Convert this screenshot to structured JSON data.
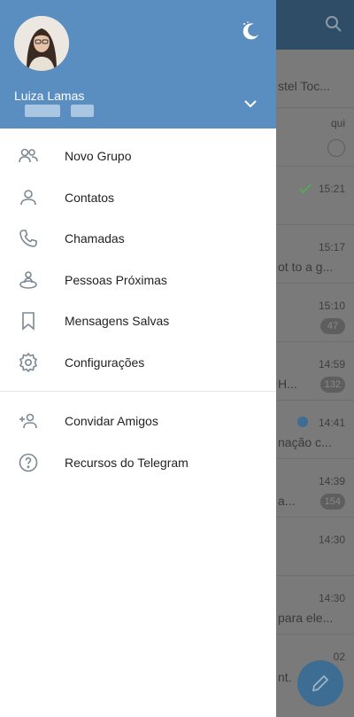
{
  "colors": {
    "drawer_header": "#5b8ec0",
    "app_header": "#2f4d66",
    "fab": "#3e6d93",
    "accent_check": "#4caf50"
  },
  "drawer": {
    "user_name": "Luiza Lamas",
    "theme_toggle_icon": "moon-icon",
    "expand_icon": "chevron-down-icon",
    "menu": [
      {
        "label": "Novo Grupo",
        "icon": "group-icon"
      },
      {
        "label": "Contatos",
        "icon": "contact-icon"
      },
      {
        "label": "Chamadas",
        "icon": "phone-icon"
      },
      {
        "label": "Pessoas Próximas",
        "icon": "people-nearby-icon"
      },
      {
        "label": "Mensagens Salvas",
        "icon": "bookmark-icon"
      },
      {
        "label": "Configurações",
        "icon": "gear-icon"
      }
    ],
    "menu_secondary": [
      {
        "label": "Convidar Amigos",
        "icon": "add-user-icon"
      },
      {
        "label": "Recursos do Telegram",
        "icon": "help-icon"
      }
    ]
  },
  "background_chats": [
    {
      "time": "",
      "preview": "stel Toc..."
    },
    {
      "time": "qui",
      "preview": ""
    },
    {
      "time": "15:21",
      "preview": ""
    },
    {
      "time": "15:17",
      "preview": "ot to a g..."
    },
    {
      "time": "15:10",
      "preview": "",
      "badge": "47"
    },
    {
      "time": "14:59",
      "preview": "H...",
      "badge": "132"
    },
    {
      "time": "14:41",
      "preview": "nação c..."
    },
    {
      "time": "14:39",
      "preview": "a...",
      "badge": "154"
    },
    {
      "time": "14:30",
      "preview": ""
    },
    {
      "time": "14:30",
      "preview": "para ele..."
    },
    {
      "time": "02",
      "preview": "nt."
    }
  ]
}
